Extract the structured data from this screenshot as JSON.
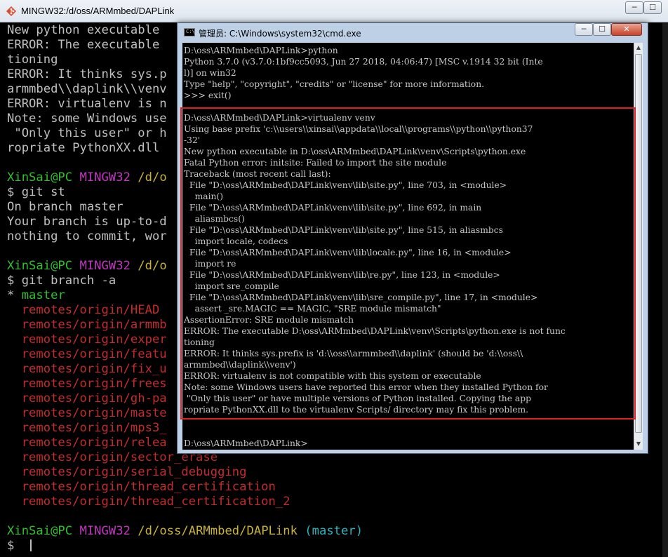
{
  "mingw": {
    "title": "MINGW32:/d/oss/ARMmbed/DAPLink",
    "controls": {
      "minimize": "─",
      "maximize": "☐",
      "close": "✕"
    },
    "lines": [
      [
        {
          "t": "New python executable"
        }
      ],
      [
        {
          "t": "ERROR: The executable"
        }
      ],
      [
        {
          "t": "tioning"
        }
      ],
      [
        {
          "t": "ERROR: It thinks sys.p"
        }
      ],
      [
        {
          "t": "armmbed\\\\daplink\\\\venv"
        }
      ],
      [
        {
          "t": "ERROR: virtualenv is n"
        }
      ],
      [
        {
          "t": "Note: some Windows use"
        }
      ],
      [
        {
          "t": " \"Only this user\" or h"
        }
      ],
      [
        {
          "t": "ropriate PythonXX.dll"
        }
      ],
      [
        {
          "t": ""
        }
      ],
      [
        {
          "t": "XinSai@PC ",
          "c": "g"
        },
        {
          "t": "MINGW32 ",
          "c": "m"
        },
        {
          "t": "/d/o",
          "c": "y"
        }
      ],
      [
        {
          "t": "$ git st"
        }
      ],
      [
        {
          "t": "On branch master"
        }
      ],
      [
        {
          "t": "Your branch is up-to-d"
        }
      ],
      [
        {
          "t": "nothing to commit, wor"
        }
      ],
      [
        {
          "t": ""
        }
      ],
      [
        {
          "t": "XinSai@PC ",
          "c": "g"
        },
        {
          "t": "MINGW32 ",
          "c": "m"
        },
        {
          "t": "/d/o",
          "c": "y"
        }
      ],
      [
        {
          "t": "$ git branch -a"
        }
      ],
      [
        {
          "t": "* "
        },
        {
          "t": "master",
          "c": "g"
        }
      ],
      [
        {
          "t": "  remotes/origin/HEAD",
          "c": "r"
        }
      ],
      [
        {
          "t": "  remotes/origin/armmb",
          "c": "r"
        }
      ],
      [
        {
          "t": "  remotes/origin/exper",
          "c": "r"
        }
      ],
      [
        {
          "t": "  remotes/origin/featu",
          "c": "r"
        }
      ],
      [
        {
          "t": "  remotes/origin/fix_u",
          "c": "r"
        }
      ],
      [
        {
          "t": "  remotes/origin/frees",
          "c": "r"
        }
      ],
      [
        {
          "t": "  remotes/origin/gh-pa",
          "c": "r"
        }
      ],
      [
        {
          "t": "  remotes/origin/maste",
          "c": "r"
        }
      ],
      [
        {
          "t": "  remotes/origin/mps3_",
          "c": "r"
        }
      ],
      [
        {
          "t": "  remotes/origin/relea",
          "c": "r"
        }
      ],
      [
        {
          "t": "  remotes/origin/sector_erase",
          "c": "r"
        }
      ],
      [
        {
          "t": "  remotes/origin/serial_debugging",
          "c": "r"
        }
      ],
      [
        {
          "t": "  remotes/origin/thread_certification",
          "c": "r"
        }
      ],
      [
        {
          "t": "  remotes/origin/thread_certification_2",
          "c": "r"
        }
      ],
      [
        {
          "t": ""
        }
      ],
      [
        {
          "t": "XinSai@PC ",
          "c": "g"
        },
        {
          "t": "MINGW32 ",
          "c": "m"
        },
        {
          "t": "/d/oss/ARMmbed/DAPLink ",
          "c": "y"
        },
        {
          "t": "(master)",
          "c": "c"
        }
      ],
      [
        {
          "t": "$ "
        }
      ]
    ]
  },
  "cmd": {
    "title": "管理员: C:\\Windows\\system32\\cmd.exe",
    "icon_text": "C:\\",
    "controls": {
      "minimize": "─",
      "maximize": "☐",
      "close": "✕"
    },
    "scroll_up": "▲",
    "scroll_down": "▼",
    "lines": [
      "D:\\oss\\ARMmbed\\DAPLink>python",
      "Python 3.7.0 (v3.7.0:1bf9cc5093, Jun 27 2018, 04:06:47) [MSC v.1914 32 bit (Inte",
      "l)] on win32",
      "Type \"help\", \"copyright\", \"credits\" or \"license\" for more information.",
      ">>> exit()",
      "",
      "D:\\oss\\ARMmbed\\DAPLink>virtualenv venv",
      "Using base prefix 'c:\\\\users\\\\xinsai\\\\appdata\\\\local\\\\programs\\\\python\\\\python37",
      "-32'",
      "New python executable in D:\\oss\\ARMmbed\\DAPLink\\venv\\Scripts\\python.exe",
      "Fatal Python error: initsite: Failed to import the site module",
      "Traceback (most recent call last):",
      "  File \"D:\\oss\\ARMmbed\\DAPLink\\venv\\lib\\site.py\", line 703, in <module>",
      "    main()",
      "  File \"D:\\oss\\ARMmbed\\DAPLink\\venv\\lib\\site.py\", line 692, in main",
      "    aliasmbcs()",
      "  File \"D:\\oss\\ARMmbed\\DAPLink\\venv\\lib\\site.py\", line 515, in aliasmbcs",
      "    import locale, codecs",
      "  File \"D:\\oss\\ARMmbed\\DAPLink\\venv\\lib\\locale.py\", line 16, in <module>",
      "    import re",
      "  File \"D:\\oss\\ARMmbed\\DAPLink\\venv\\lib\\re.py\", line 123, in <module>",
      "    import sre_compile",
      "  File \"D:\\oss\\ARMmbed\\DAPLink\\venv\\lib\\sre_compile.py\", line 17, in <module>",
      "    assert _sre.MAGIC == MAGIC, \"SRE module mismatch\"",
      "AssertionError: SRE module mismatch",
      "ERROR: The executable D:\\oss\\ARMmbed\\DAPLink\\venv\\Scripts\\python.exe is not func",
      "tioning",
      "ERROR: It thinks sys.prefix is 'd:\\\\oss\\\\armmbed\\\\daplink' (should be 'd:\\\\oss\\\\",
      "armmbed\\\\daplink\\\\venv')",
      "ERROR: virtualenv is not compatible with this system or executable",
      "Note: some Windows users have reported this error when they installed Python for",
      " \"Only this user\" or have multiple versions of Python installed. Copying the app",
      "ropriate PythonXX.dll to the virtualenv Scripts/ directory may fix this problem.",
      "",
      "",
      "D:\\oss\\ARMmbed\\DAPLink>"
    ]
  },
  "colors": {
    "prompt_user": "#2fbf2f",
    "prompt_host": "#c036c0",
    "prompt_path": "#c8b23a",
    "branch": "#2ab3bd",
    "remote_branch": "#c42b2b",
    "highlight": "#e02020"
  }
}
